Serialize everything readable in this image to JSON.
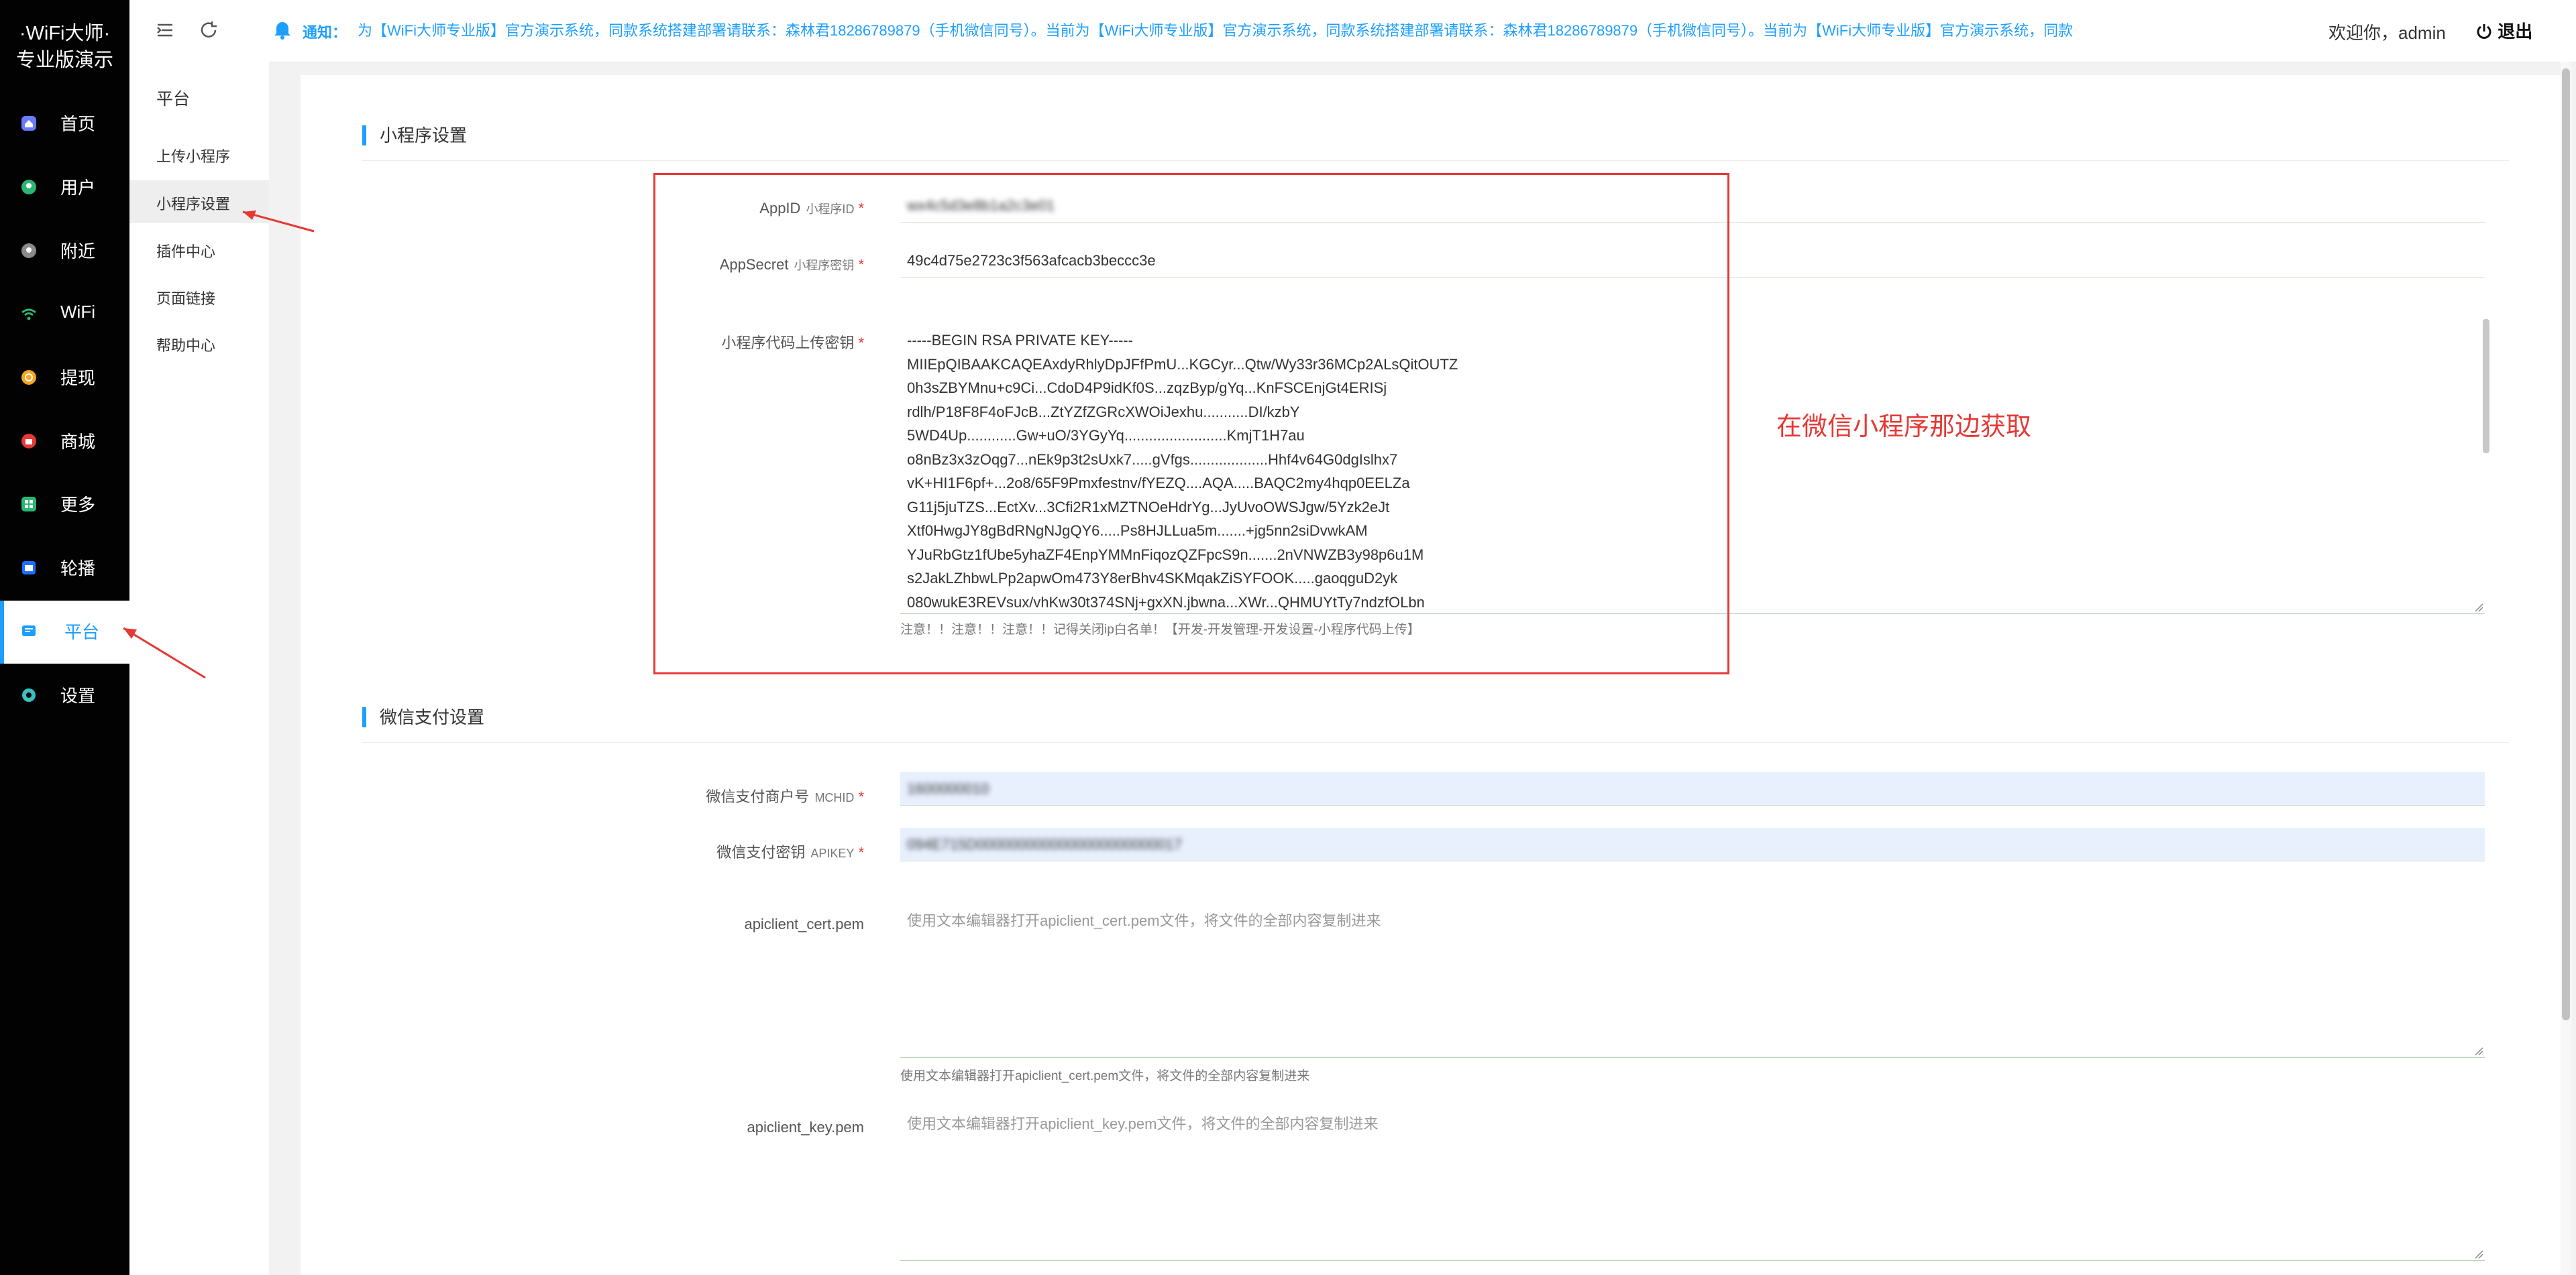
{
  "app": {
    "logo_line1": "·WiFi大师·",
    "logo_line2": "专业版演示"
  },
  "sidebar": {
    "items": [
      {
        "label": "首页",
        "icon": "home-icon",
        "color": "#6b7bff"
      },
      {
        "label": "用户",
        "icon": "user-icon",
        "color": "#2bb673"
      },
      {
        "label": "附近",
        "icon": "location-icon",
        "color": "#8a8a8a"
      },
      {
        "label": "WiFi",
        "icon": "wifi-icon",
        "color": "#2bb673"
      },
      {
        "label": "提现",
        "icon": "coin-icon",
        "color": "#f5a623"
      },
      {
        "label": "商城",
        "icon": "shop-icon",
        "color": "#e53935"
      },
      {
        "label": "更多",
        "icon": "grid-icon",
        "color": "#2bb673"
      },
      {
        "label": "轮播",
        "icon": "carousel-icon",
        "color": "#1e6fff"
      },
      {
        "label": "平台",
        "icon": "platform-icon",
        "color": "#1e9fff"
      },
      {
        "label": "设置",
        "icon": "gear-icon",
        "color": "#39c0c0"
      }
    ],
    "active": "平台"
  },
  "submenu": {
    "title": "平台",
    "items": [
      "上传小程序",
      "小程序设置",
      "插件中心",
      "页面链接",
      "帮助中心"
    ],
    "active": "小程序设置"
  },
  "header": {
    "notice_label": "通知：",
    "notice_text": "为【WiFi大师专业版】官方演示系统，同款系统搭建部署请联系：森林君18286789879（手机微信同号）。当前为【WiFi大师专业版】官方演示系统，同款系统搭建部署请联系：森林君18286789879（手机微信同号）。当前为【WiFi大师专业版】官方演示系统，同款",
    "welcome": "欢迎你，admin",
    "logout": "退出"
  },
  "miniprogram": {
    "section_title": "小程序设置",
    "appid_label": "AppID",
    "appid_sub": "小程序ID",
    "appid_value": "wx4c5d3e8b1a2c3e01",
    "appsecret_label": "AppSecret",
    "appsecret_sub": "小程序密钥",
    "appsecret_value": "49c4d75e2723c3f563afcacb3beccc3e",
    "upload_key_label": "小程序代码上传密钥",
    "upload_key_lines": [
      "-----BEGIN RSA PRIVATE KEY-----",
      "MIIEpQIBAAKCAQEAxdyRhlyDpJFfPmU...KGCyr...Qtw/Wy33r36MCp2ALsQitOUTZ",
      "0h3sZBYMnu+c9Ci...CdoD4P9idKf0S...zqzByp/gYq...KnFSCEnjGt4ERISj",
      "rdlh/P18F8F4oFJcB...ZtYZfZGRcXWOiJexhu...........DI/kzbY",
      "5WD4Up............Gw+uO/3YGyYq.........................KmjT1H7au",
      "o8nBz3x3zOqg7...nEk9p3t2sUxk7.....gVfgs...................Hhf4v64G0dgIslhx7",
      "vK+HI1F6pf+...2o8/65F9Pmxfestnv/fYEZQ....AQA.....BAQC2my4hqp0EELZa",
      "G11j5juTZS...EctXv...3Cfi2R1xMZTNOeHdrYg...JyUvoOWSJgw/5Yzk2eJt",
      "Xtf0HwgJY8gBdRNgNJgQY6.....Ps8HJLLua5m.......+jg5nn2siDvwkAM",
      "YJuRbGtz1fUbe5yhaZF4EnpYMMnFiqozQZFpcS9n.......2nVNWZB3y98p6u1M",
      "s2JakLZhbwLPp2apwOm473Y8erBhv4SKMqakZiSYFOOK.....gaoqguD2yk",
      "080wukE3REVsux/vhKw30t374SNj+gxXN.jbwna...XWr...QHMUYtTy7ndzfOLbn"
    ],
    "upload_key_tip": "注意！！注意！！注意！！记得关闭ip白名单！【开发-开发管理-开发设置-小程序代码上传】"
  },
  "payment": {
    "section_title": "微信支付设置",
    "mchid_label": "微信支付商户号",
    "mchid_sub": "MCHID",
    "mchid_value": "1600000010",
    "apikey_label": "微信支付密钥",
    "apikey_sub": "APIKEY",
    "apikey_value": "094E715D0000000000000000000000017",
    "cert_label": "apiclient_cert.pem",
    "cert_placeholder": "使用文本编辑器打开apiclient_cert.pem文件，将文件的全部内容复制进来",
    "cert_tip": "使用文本编辑器打开apiclient_cert.pem文件，将文件的全部内容复制进来",
    "key_label": "apiclient_key.pem",
    "key_placeholder": "使用文本编辑器打开apiclient_key.pem文件，将文件的全部内容复制进来"
  },
  "annotation": {
    "text": "在微信小程序那边获取",
    "color": "#e53935"
  },
  "colors": {
    "accent": "#1e9fff",
    "sidebar_bg": "#020202",
    "required": "#e53935"
  }
}
